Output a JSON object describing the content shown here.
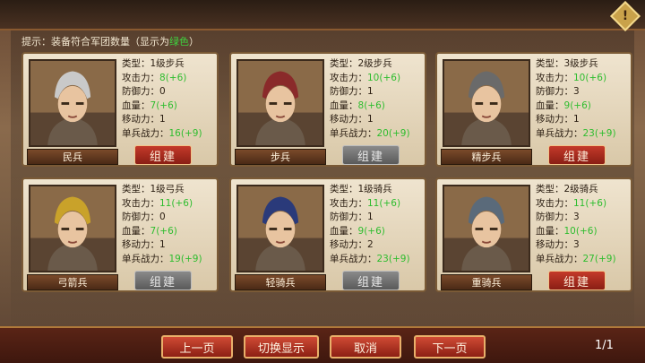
{
  "hint": {
    "prefix": "提示：装备符合军团数量（显示为",
    "green": "绿色",
    "suffix": "）"
  },
  "warning_icon": "exclamation-diamond-icon",
  "labels": {
    "type": "类型：",
    "attack": "攻击力：",
    "defense": "防御力：",
    "hp": "血量：",
    "move": "移动力：",
    "power": "单兵战力："
  },
  "units": [
    {
      "name": "民兵",
      "type": "1级步兵",
      "attack": "8",
      "attack_bonus": "(+6)",
      "defense": "0",
      "hp": "7",
      "hp_bonus": "(+6)",
      "move": "1",
      "power": "16",
      "power_bonus": "(+9)",
      "button": "组建",
      "button_state": "active"
    },
    {
      "name": "步兵",
      "type": "2级步兵",
      "attack": "10",
      "attack_bonus": "(+6)",
      "defense": "1",
      "hp": "8",
      "hp_bonus": "(+6)",
      "move": "1",
      "power": "20",
      "power_bonus": "(+9)",
      "button": "组建",
      "button_state": "disabled"
    },
    {
      "name": "精步兵",
      "type": "3级步兵",
      "attack": "10",
      "attack_bonus": "(+6)",
      "defense": "3",
      "hp": "9",
      "hp_bonus": "(+6)",
      "move": "1",
      "power": "23",
      "power_bonus": "(+9)",
      "button": "组建",
      "button_state": "active"
    },
    {
      "name": "弓箭兵",
      "type": "1级弓兵",
      "attack": "11",
      "attack_bonus": "(+6)",
      "defense": "0",
      "hp": "7",
      "hp_bonus": "(+6)",
      "move": "1",
      "power": "19",
      "power_bonus": "(+9)",
      "button": "组建",
      "button_state": "disabled"
    },
    {
      "name": "轻骑兵",
      "type": "1级骑兵",
      "attack": "11",
      "attack_bonus": "(+6)",
      "defense": "1",
      "hp": "9",
      "hp_bonus": "(+6)",
      "move": "2",
      "power": "23",
      "power_bonus": "(+9)",
      "button": "组建",
      "button_state": "disabled"
    },
    {
      "name": "重骑兵",
      "type": "2级骑兵",
      "attack": "11",
      "attack_bonus": "(+6)",
      "defense": "3",
      "hp": "10",
      "hp_bonus": "(+6)",
      "move": "3",
      "power": "27",
      "power_bonus": "(+9)",
      "button": "组建",
      "button_state": "active"
    }
  ],
  "footer": {
    "prev": "上一页",
    "toggle": "切换显示",
    "cancel": "取消",
    "next": "下一页",
    "page": "1/1"
  },
  "colors": {
    "bonus_green": "#2fbd2f",
    "button_red": "#c43a2a",
    "button_gray": "#7a7a7a"
  }
}
